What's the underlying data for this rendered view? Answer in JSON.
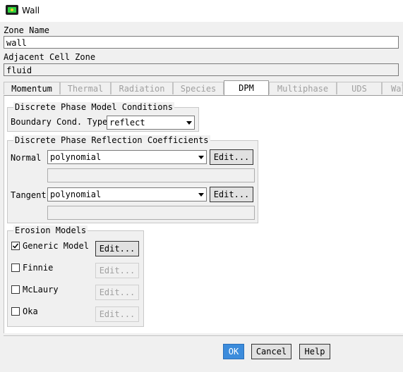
{
  "window": {
    "title": "Wall"
  },
  "zone_name": {
    "label": "Zone Name",
    "value": "wall"
  },
  "adjacent_cell_zone": {
    "label": "Adjacent Cell Zone",
    "value": "fluid"
  },
  "tabs": [
    {
      "label": "Momentum",
      "enabled": true
    },
    {
      "label": "Thermal",
      "enabled": false
    },
    {
      "label": "Radiation",
      "enabled": false
    },
    {
      "label": "Species",
      "enabled": false
    },
    {
      "label": "DPM",
      "enabled": true,
      "active": true
    },
    {
      "label": "Multiphase",
      "enabled": false
    },
    {
      "label": "UDS",
      "enabled": false
    },
    {
      "label": "Wal",
      "enabled": false
    }
  ],
  "dpm_conditions": {
    "legend": "Discrete Phase Model Conditions",
    "bc_label": "Boundary Cond. Type",
    "bc_value": "reflect"
  },
  "reflection": {
    "legend": "Discrete Phase Reflection Coefficients",
    "normal_label": "Normal",
    "normal_value": "polynomial",
    "tangent_label": "Tangent",
    "tangent_value": "polynomial",
    "edit_label": "Edit..."
  },
  "erosion": {
    "legend": "Erosion Models",
    "models": [
      {
        "label": "Generic Model",
        "checked": true,
        "edit_label": "Edit...",
        "edit_enabled": true
      },
      {
        "label": "Finnie",
        "checked": false,
        "edit_label": "Edit...",
        "edit_enabled": false
      },
      {
        "label": "McLaury",
        "checked": false,
        "edit_label": "Edit...",
        "edit_enabled": false
      },
      {
        "label": "Oka",
        "checked": false,
        "edit_label": "Edit...",
        "edit_enabled": false
      }
    ]
  },
  "footer": {
    "ok": "OK",
    "cancel": "Cancel",
    "help": "Help"
  },
  "colors": {
    "ok_button": "#3c8cdc",
    "active_tab": "#ffffff",
    "panel": "#f0f0f0"
  }
}
